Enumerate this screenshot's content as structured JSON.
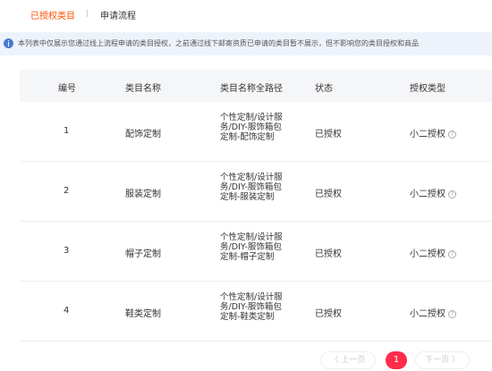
{
  "tabs": {
    "active": "已授权类目",
    "second": "申请流程"
  },
  "notice": {
    "text": "本列表中仅展示您通过线上流程申请的类目授权，之前通过线下邮寄资质已申请的类目暂不展示，但不影响您的类目授权和商品"
  },
  "table": {
    "headers": [
      "编号",
      "类目名称",
      "类目名称全路径",
      "状态",
      "授权类型"
    ],
    "rows": [
      {
        "id": "1",
        "name": "配饰定制",
        "path": [
          "个性定制/设计服",
          "务/DIY-服饰箱包",
          "定制-配饰定制"
        ],
        "status": "已授权",
        "type": "小二授权"
      },
      {
        "id": "2",
        "name": "服装定制",
        "path": [
          "个性定制/设计服",
          "务/DIY-服饰箱包",
          "定制-服装定制"
        ],
        "status": "已授权",
        "type": "小二授权"
      },
      {
        "id": "3",
        "name": "帽子定制",
        "path": [
          "个性定制/设计服",
          "务/DIY-服饰箱包",
          "定制-帽子定制"
        ],
        "status": "已授权",
        "type": "小二授权"
      },
      {
        "id": "4",
        "name": "鞋类定制",
        "path": [
          "个性定制/设计服",
          "务/DIY-服饰箱包",
          "定制-鞋类定制"
        ],
        "status": "已授权",
        "type": "小二授权"
      }
    ]
  },
  "pagination": {
    "prev": "〈 上一页",
    "current": "1",
    "next": "下一页 〉"
  },
  "icons": {
    "info": "info-icon",
    "help": "question-icon"
  },
  "colors": {
    "accent": "#ff5000",
    "page_active": "#ff2c4a",
    "notice_bg": "#eef3fb",
    "header_bg": "#f5f6f8"
  }
}
